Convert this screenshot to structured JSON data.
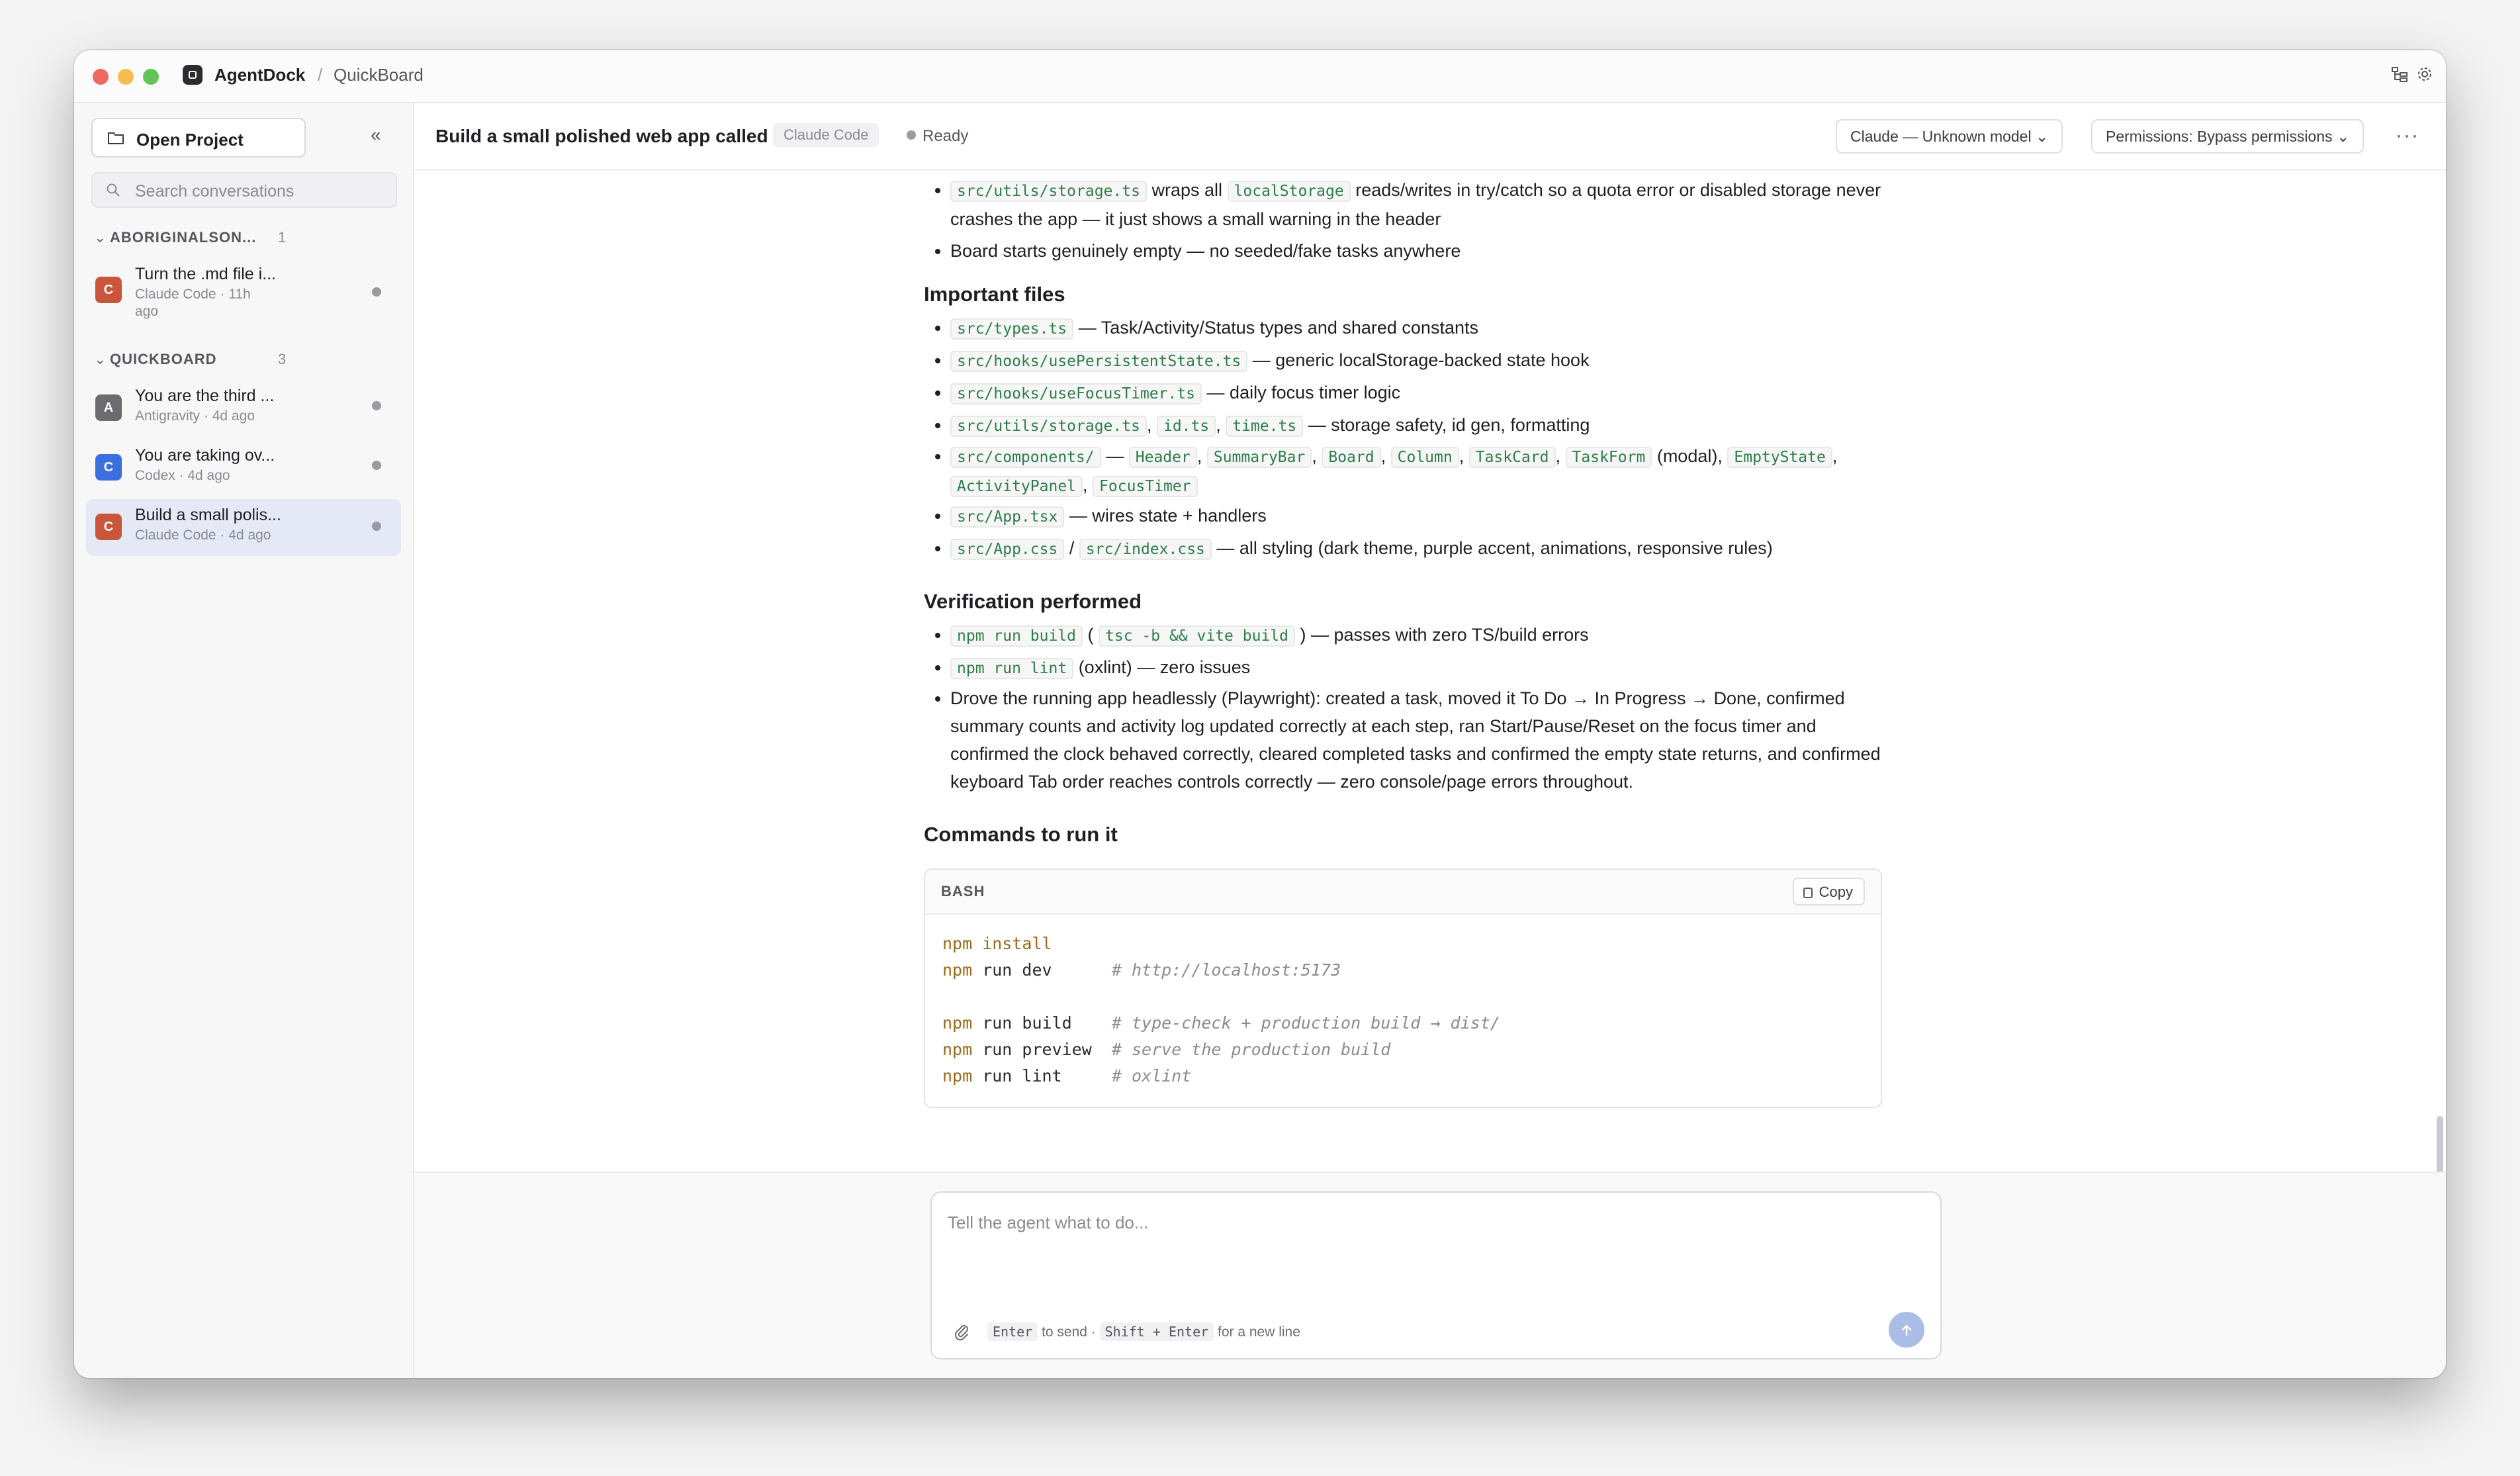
{
  "app": {
    "name": "AgentDock",
    "separator": "/",
    "project": "QuickBoard"
  },
  "sidebar": {
    "open_project_label": "Open Project",
    "search_placeholder": "Search conversations",
    "groups": [
      {
        "name": "ABORIGINALSON...",
        "count": "1",
        "items": [
          {
            "title": "Turn the .md file i...",
            "meta": "Claude Code · 11h ago",
            "avatar": "C",
            "color": "#c9563a"
          }
        ]
      },
      {
        "name": "QUICKBOARD",
        "count": "3",
        "items": [
          {
            "title": "You are the third ...",
            "meta": "Antigravity · 4d ago",
            "avatar": "A",
            "color": "#6b6b70"
          },
          {
            "title": "You are taking ov...",
            "meta": "Codex · 4d ago",
            "avatar": "C",
            "color": "#3b6fe0"
          },
          {
            "title": "Build a small polis...",
            "meta": "Claude Code · 4d ago",
            "avatar": "C",
            "color": "#c9563a",
            "active": true
          }
        ]
      }
    ]
  },
  "header": {
    "title": "Build a small polished web app called",
    "agent": "Claude Code",
    "status": "Ready",
    "model_select": "Claude — Unknown model",
    "permissions_select": "Permissions: Bypass permissions",
    "more": "···"
  },
  "message": {
    "top_bullets": {
      "b1_code1": "src/utils/storage.ts",
      "b1_t1": "wraps all",
      "b1_code2": "localStorage",
      "b1_t2": "reads/writes in try/catch so a quota error or disabled storage never crashes the app — it just shows a small warning in the header",
      "b2": "Board starts genuinely empty — no seeded/fake tasks anywhere"
    },
    "important_files": {
      "heading": "Important files",
      "types_code": "src/types.ts",
      "types_text": "— Task/Activity/Status types and shared constants",
      "persist_code": "src/hooks/usePersistentState.ts",
      "persist_text": "— generic localStorage-backed state hook",
      "focus_code": "src/hooks/useFocusTimer.ts",
      "focus_text": "— daily focus timer logic",
      "utils_code1": "src/utils/storage.ts",
      "utils_code2": "id.ts",
      "utils_code3": "time.ts",
      "utils_text": "— storage safety, id gen, formatting",
      "comp_code": "src/components/",
      "comp_dash": "—",
      "comp_header": "Header",
      "comp_summary": "SummaryBar",
      "comp_board": "Board",
      "comp_column": "Column",
      "comp_taskcard": "TaskCard",
      "comp_taskform": "TaskForm",
      "comp_modal": "(modal),",
      "comp_empty": "EmptyState",
      "comp_activity": "ActivityPanel",
      "comp_focus": "FocusTimer",
      "app_code": "src/App.tsx",
      "app_text": "— wires state + handlers",
      "css_code1": "src/App.css",
      "css_sep": "/",
      "css_code2": "src/index.css",
      "css_text": "— all styling (dark theme, purple accent, animations, responsive rules)"
    },
    "verification": {
      "heading": "Verification performed",
      "build_code": "npm run build",
      "build_paren_open": "(",
      "build_code2": "tsc -b && vite build",
      "build_text": ") — passes with zero TS/build errors",
      "lint_code": "npm run lint",
      "lint_text": "(oxlint) — zero issues",
      "drove": "Drove the running app headlessly (Playwright): created a task, moved it To Do → In Progress → Done, confirmed summary counts and activity log updated correctly at each step, ran Start/Pause/Reset on the focus timer and confirmed the clock behaved correctly, cleared completed tasks and confirmed the empty state returns, and confirmed keyboard Tab order reaches controls correctly — zero console/page errors throughout."
    },
    "commands": {
      "heading": "Commands to run it",
      "lang": "BASH",
      "copy_label": "Copy",
      "lines": [
        {
          "cmd": "npm",
          "args": " install",
          "comment": ""
        },
        {
          "cmd": "npm",
          "args": " run dev      ",
          "comment": "# http://localhost:5173"
        },
        {
          "cmd": "",
          "args": "",
          "comment": ""
        },
        {
          "cmd": "npm",
          "args": " run build    ",
          "comment": "# type-check + production build → dist/"
        },
        {
          "cmd": "npm",
          "args": " run preview  ",
          "comment": "# serve the production build"
        },
        {
          "cmd": "npm",
          "args": " run lint     ",
          "comment": "# oxlint"
        }
      ]
    }
  },
  "composer": {
    "placeholder": "Tell the agent what to do...",
    "enter_key": "Enter",
    "to_send": "to send ·",
    "shift_enter_key": "Shift + Enter",
    "new_line": "for a new line"
  },
  "icons": {
    "folder": "folder-icon",
    "collapse": "chevrons-left-icon",
    "search": "search-icon",
    "tree": "file-tree-icon",
    "settings": "gear-icon",
    "attach": "paperclip-icon",
    "send": "arrow-up-icon",
    "copy": "copy-icon"
  }
}
